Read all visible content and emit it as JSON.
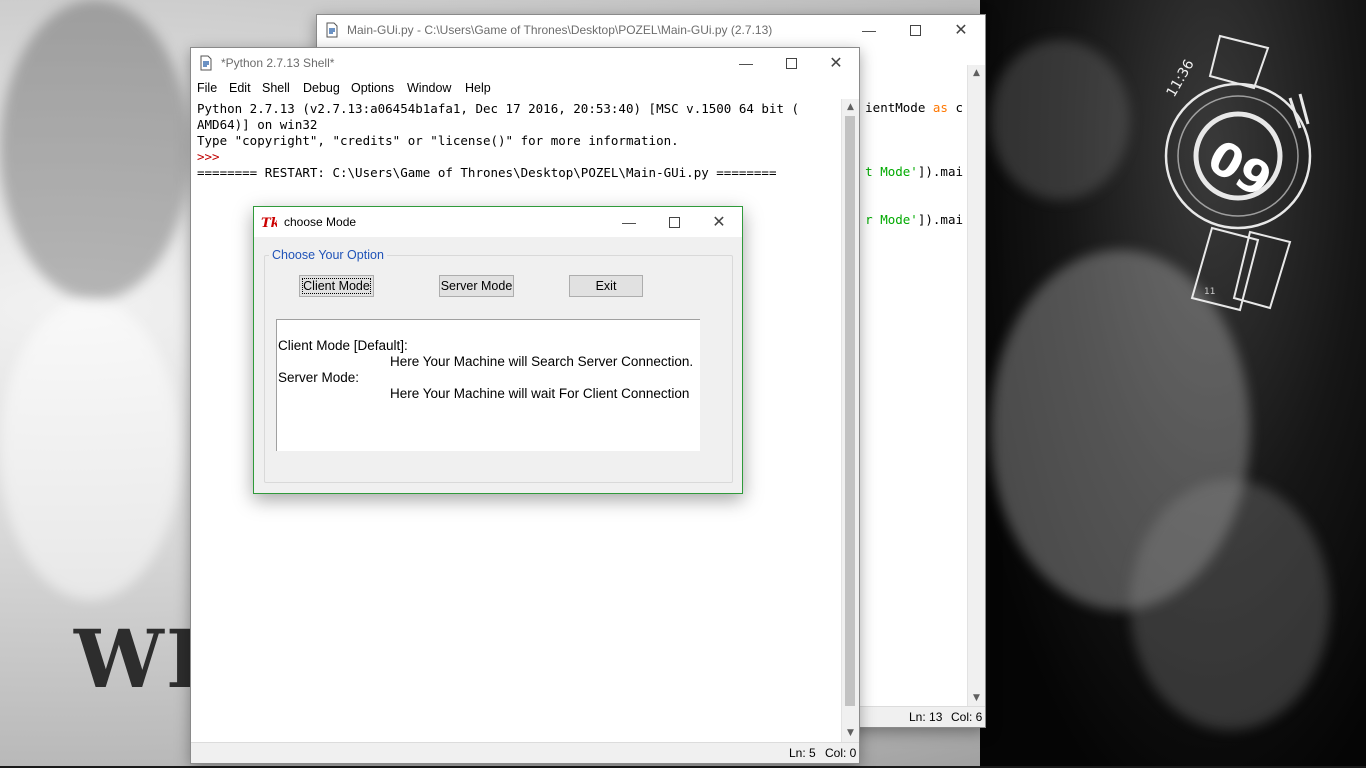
{
  "wallpaper": {
    "text": "WI",
    "clock": {
      "time": "11:36",
      "number": "09",
      "small": "11"
    }
  },
  "editor_window": {
    "title": "Main-GUi.py - C:\\Users\\Game of Thrones\\Desktop\\POZEL\\Main-GUi.py (2.7.13)",
    "code_lines": [
      {
        "text": "ientMode ",
        "keyword": "as",
        "tail": " c"
      },
      {
        "text": "",
        "green": "t Mode'",
        "tail": "]).mai"
      },
      {
        "text": "",
        "green": "r Mode'",
        "tail": "]).mai"
      }
    ],
    "status": {
      "line": "Ln: 13",
      "col": "Col: 6"
    }
  },
  "shell_window": {
    "title": "*Python 2.7.13 Shell*",
    "menu": [
      "File",
      "Edit",
      "Shell",
      "Debug",
      "Options",
      "Window",
      "Help"
    ],
    "lines": [
      "Python 2.7.13 (v2.7.13:a06454b1afa1, Dec 17 2016, 20:53:40) [MSC v.1500 64 bit (",
      "AMD64)] on win32",
      "Type \"copyright\", \"credits\" or \"license()\" for more information.",
      ">>> ",
      "======== RESTART: C:\\Users\\Game of Thrones\\Desktop\\POZEL\\Main-GUi.py ========"
    ],
    "status": {
      "line": "Ln: 5",
      "col": "Col: 0"
    }
  },
  "dialog": {
    "title": "choose Mode",
    "group_label": "Choose Your Option",
    "buttons": {
      "client": "Client Mode",
      "server": "Server Mode",
      "exit": "Exit"
    },
    "text_lines": [
      "Client Mode [Default]:",
      "Here Your Machine will Search Server Connection.",
      "Server Mode:",
      "Here Your Machine will wait For Client Connection"
    ]
  },
  "icons": {
    "minimize": "minimize-icon",
    "maximize": "maximize-icon",
    "close": "close-icon",
    "tk_logo": "tk-feather-icon",
    "idle_file": "python-file-icon"
  },
  "colors": {
    "prompt_red": "#c00000",
    "keyword_orange": "#ff7700",
    "string_green": "#00aa00",
    "dialog_border": "#2f9a3a",
    "group_label_blue": "#2053b8"
  }
}
